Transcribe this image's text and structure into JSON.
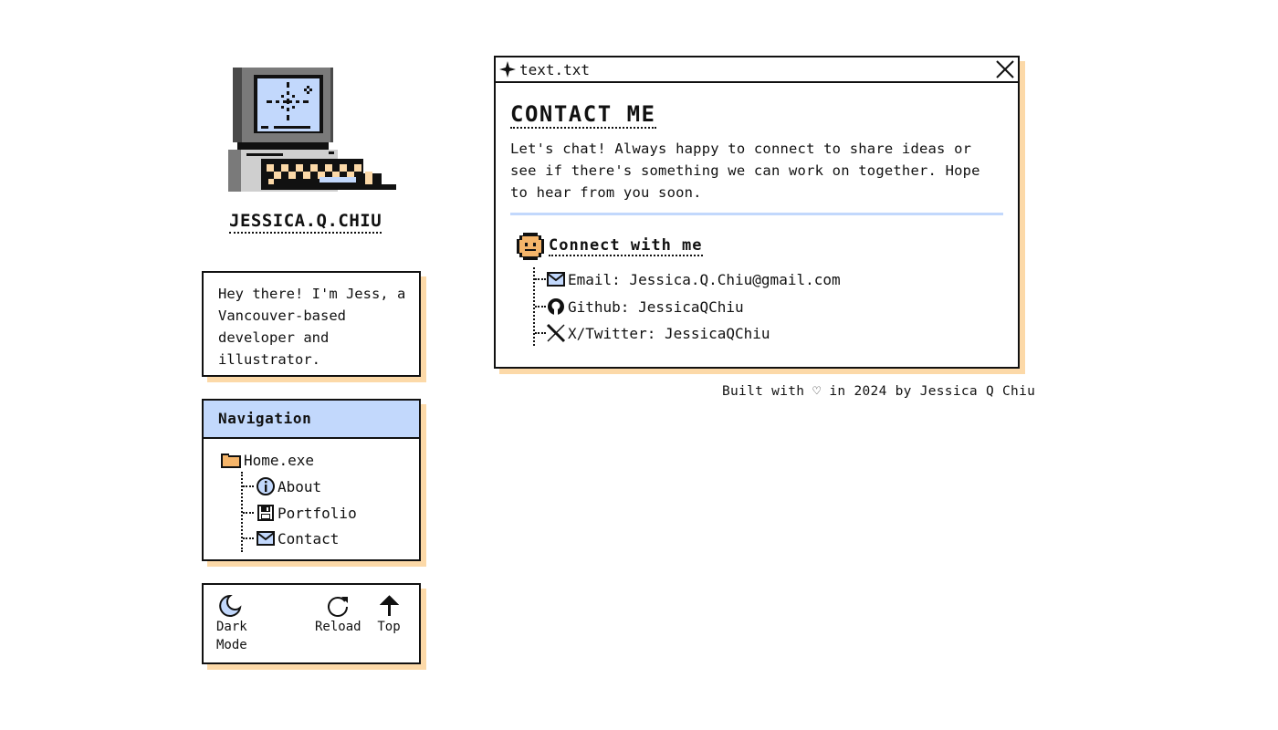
{
  "site": {
    "name": "JESSICA.Q.CHIU"
  },
  "intro": {
    "text": "Hey there! I'm Jess, a Vancouver-based developer and illustrator."
  },
  "nav": {
    "heading": "Navigation",
    "root": "Home.exe",
    "items": [
      {
        "label": "About",
        "icon": "info-icon"
      },
      {
        "label": "Portfolio",
        "icon": "floppy-disk-icon"
      },
      {
        "label": "Contact",
        "icon": "envelope-icon"
      }
    ]
  },
  "tools": {
    "dark_mode": "Dark\nMode",
    "reload": "Reload",
    "top": "Top"
  },
  "window": {
    "title": "text.txt",
    "heading": "CONTACT ME",
    "description": "Let's chat! Always happy to connect to share ideas or see if there's something we can work on together. Hope to hear from you soon.",
    "connect_heading": "Connect with me",
    "links": [
      {
        "label": "Email: Jessica.Q.Chiu@gmail.com",
        "icon": "envelope-icon"
      },
      {
        "label": "Github: JessicaQChiu",
        "icon": "github-icon"
      },
      {
        "label": "X/Twitter: JessicaQChiu",
        "icon": "x-twitter-icon"
      }
    ]
  },
  "footer": {
    "text": "Built with ♡ in 2024 by Jessica Q Chiu"
  },
  "colors": {
    "accent_blue": "#c2d8fc",
    "shadow_peach": "#fcd9a8",
    "ink": "#111111"
  }
}
